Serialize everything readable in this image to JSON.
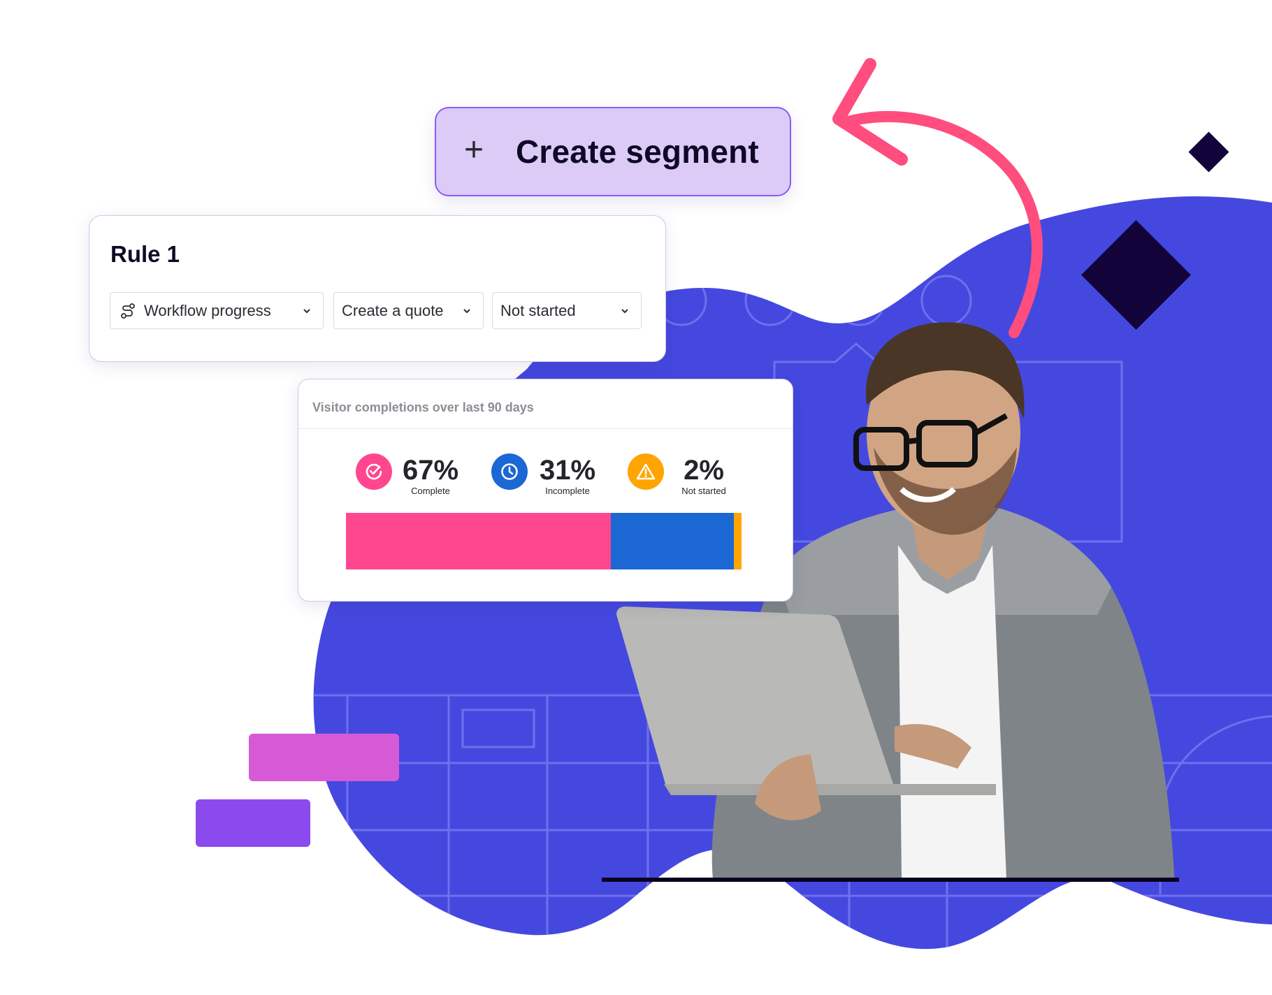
{
  "create_segment": {
    "icon": "plus-icon",
    "label": "Create segment"
  },
  "rule": {
    "title": "Rule 1",
    "dropdowns": [
      {
        "icon": "workflow-icon",
        "value": "Workflow progress"
      },
      {
        "value": "Create a quote"
      },
      {
        "value": "Not started"
      }
    ]
  },
  "visitor_card": {
    "title": "Visitor completions over last 90 days",
    "stats": [
      {
        "percent": "67%",
        "label": "Complete",
        "icon": "check-circle-icon",
        "color": "#ff4790",
        "value": 67
      },
      {
        "percent": "31%",
        "label": "Incomplete",
        "icon": "clock-icon",
        "color": "#1b68d4",
        "value": 31
      },
      {
        "percent": "2%",
        "label": "Not started",
        "icon": "warning-icon",
        "color": "#ffa400",
        "value": 2
      }
    ]
  },
  "colors": {
    "blob": "#4548df",
    "arrow": "#ff4d7e",
    "diamond": "#12043a",
    "deco_pink": "#d65ad6",
    "deco_purple": "#8b4aee",
    "button_bg": "#dccbf7",
    "button_border": "#8b5cf6"
  }
}
